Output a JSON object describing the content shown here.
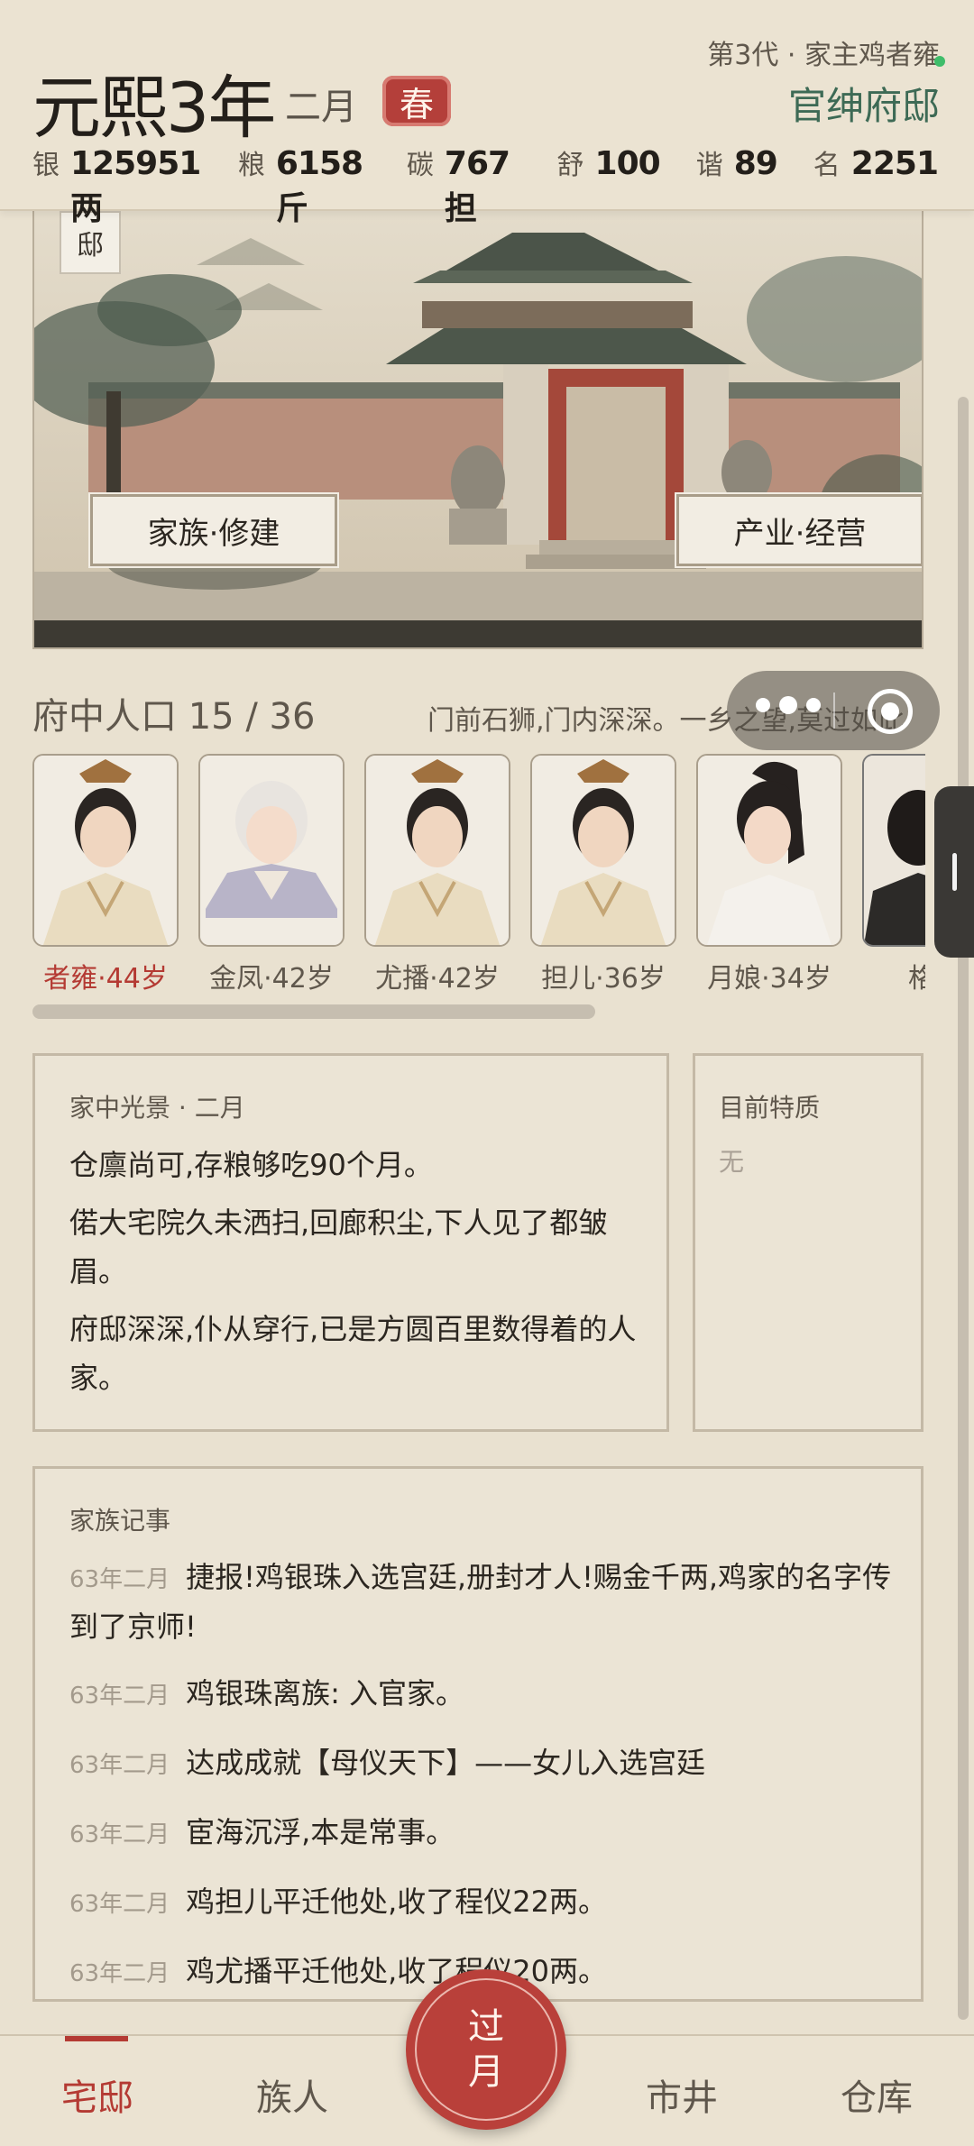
{
  "header": {
    "year": "元熙3年",
    "month": "二月",
    "season": "春",
    "generation": "第3代 · 家主鸡者雍",
    "residence": "官绅府邸",
    "stats": [
      {
        "label": "银",
        "value": "125951两"
      },
      {
        "label": "粮",
        "value": "6158斤"
      },
      {
        "label": "碳",
        "value": "767担"
      },
      {
        "label": "舒",
        "value": "100"
      },
      {
        "label": "谐",
        "value": "89"
      },
      {
        "label": "名",
        "value": "2251"
      }
    ]
  },
  "banner": {
    "tag": "邸",
    "left_button": "家族·修建",
    "right_button": "产业·经营"
  },
  "population": {
    "title": "府中人口 15 / 36",
    "description": "门前石狮,门内深深。一乡之望,莫过如此",
    "people": [
      {
        "name": "者雍·44岁",
        "is_head": true
      },
      {
        "name": "金凤·42岁",
        "is_head": false
      },
      {
        "name": "尤播·42岁",
        "is_head": false
      },
      {
        "name": "担儿·36岁",
        "is_head": false
      },
      {
        "name": "月娘·34岁",
        "is_head": false
      },
      {
        "name": "格格",
        "is_head": false
      }
    ]
  },
  "scene": {
    "title": "家中光景 · 二月",
    "lines": [
      "仓廪尚可,存粮够吃90个月。",
      "偌大宅院久未洒扫,回廊积尘,下人见了都皱眉。",
      "府邸深深,仆从穿行,已是方圆百里数得着的人家。"
    ]
  },
  "traits": {
    "title": "目前特质",
    "value": "无"
  },
  "records": {
    "title": "家族记事",
    "items": [
      {
        "date": "63年二月",
        "text": "捷报!鸡银珠入选宫廷,册封才人!赐金千两,鸡家的名字传到了京师!"
      },
      {
        "date": "63年二月",
        "text": "鸡银珠离族: 入官家。"
      },
      {
        "date": "63年二月",
        "text": "达成成就【母仪天下】——女儿入选宫廷"
      },
      {
        "date": "63年二月",
        "text": "宦海沉浮,本是常事。"
      },
      {
        "date": "63年二月",
        "text": "鸡担儿平迁他处,收了程仪22两。"
      },
      {
        "date": "63年二月",
        "text": "鸡尤播平迁他处,收了程仪20两。"
      }
    ]
  },
  "nav": {
    "home": "宅邸",
    "clan": "族人",
    "next_month": "过月",
    "market": "市井",
    "storage": "仓库"
  },
  "colors": {
    "accent_red": "#b43a33",
    "residence_green": "#3d6a55",
    "background": "#e9e1d0"
  }
}
